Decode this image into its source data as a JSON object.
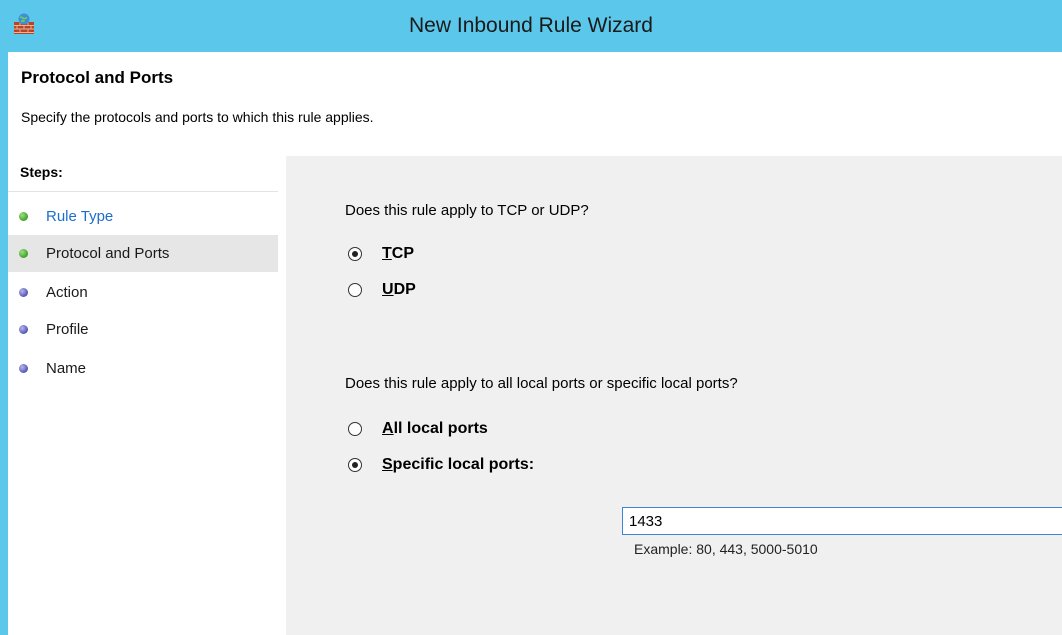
{
  "window": {
    "title": "New Inbound Rule Wizard",
    "icon": "firewall-icon"
  },
  "header": {
    "title": "Protocol and Ports",
    "subtitle": "Specify the protocols and ports to which this rule applies."
  },
  "steps": {
    "label": "Steps:",
    "items": [
      {
        "label": "Rule Type",
        "state": "done-link"
      },
      {
        "label": "Protocol and Ports",
        "state": "current"
      },
      {
        "label": "Action",
        "state": "pending"
      },
      {
        "label": "Profile",
        "state": "pending"
      },
      {
        "label": "Name",
        "state": "pending"
      }
    ]
  },
  "protocol": {
    "question": "Does this rule apply to TCP or UDP?",
    "options": [
      {
        "label": "TCP",
        "mnemonic": "T",
        "rest": "CP",
        "checked": true
      },
      {
        "label": "UDP",
        "mnemonic": "U",
        "rest": "DP",
        "checked": false
      }
    ]
  },
  "ports": {
    "question": "Does this rule apply to all local ports or specific local ports?",
    "options": [
      {
        "label": "All local ports",
        "mnemonic": "A",
        "rest": "ll local ports",
        "checked": false
      },
      {
        "label": "Specific local ports:",
        "mnemonic": "S",
        "rest": "pecific local ports:",
        "checked": true
      }
    ],
    "value": "1433",
    "example": "Example: 80, 443, 5000-5010"
  },
  "colors": {
    "title_bar": "#5bc8eb",
    "content_bg": "#f0f0f0",
    "link": "#1c6ecc",
    "step_done": "#3ca02a",
    "step_pending": "#5454b4"
  }
}
